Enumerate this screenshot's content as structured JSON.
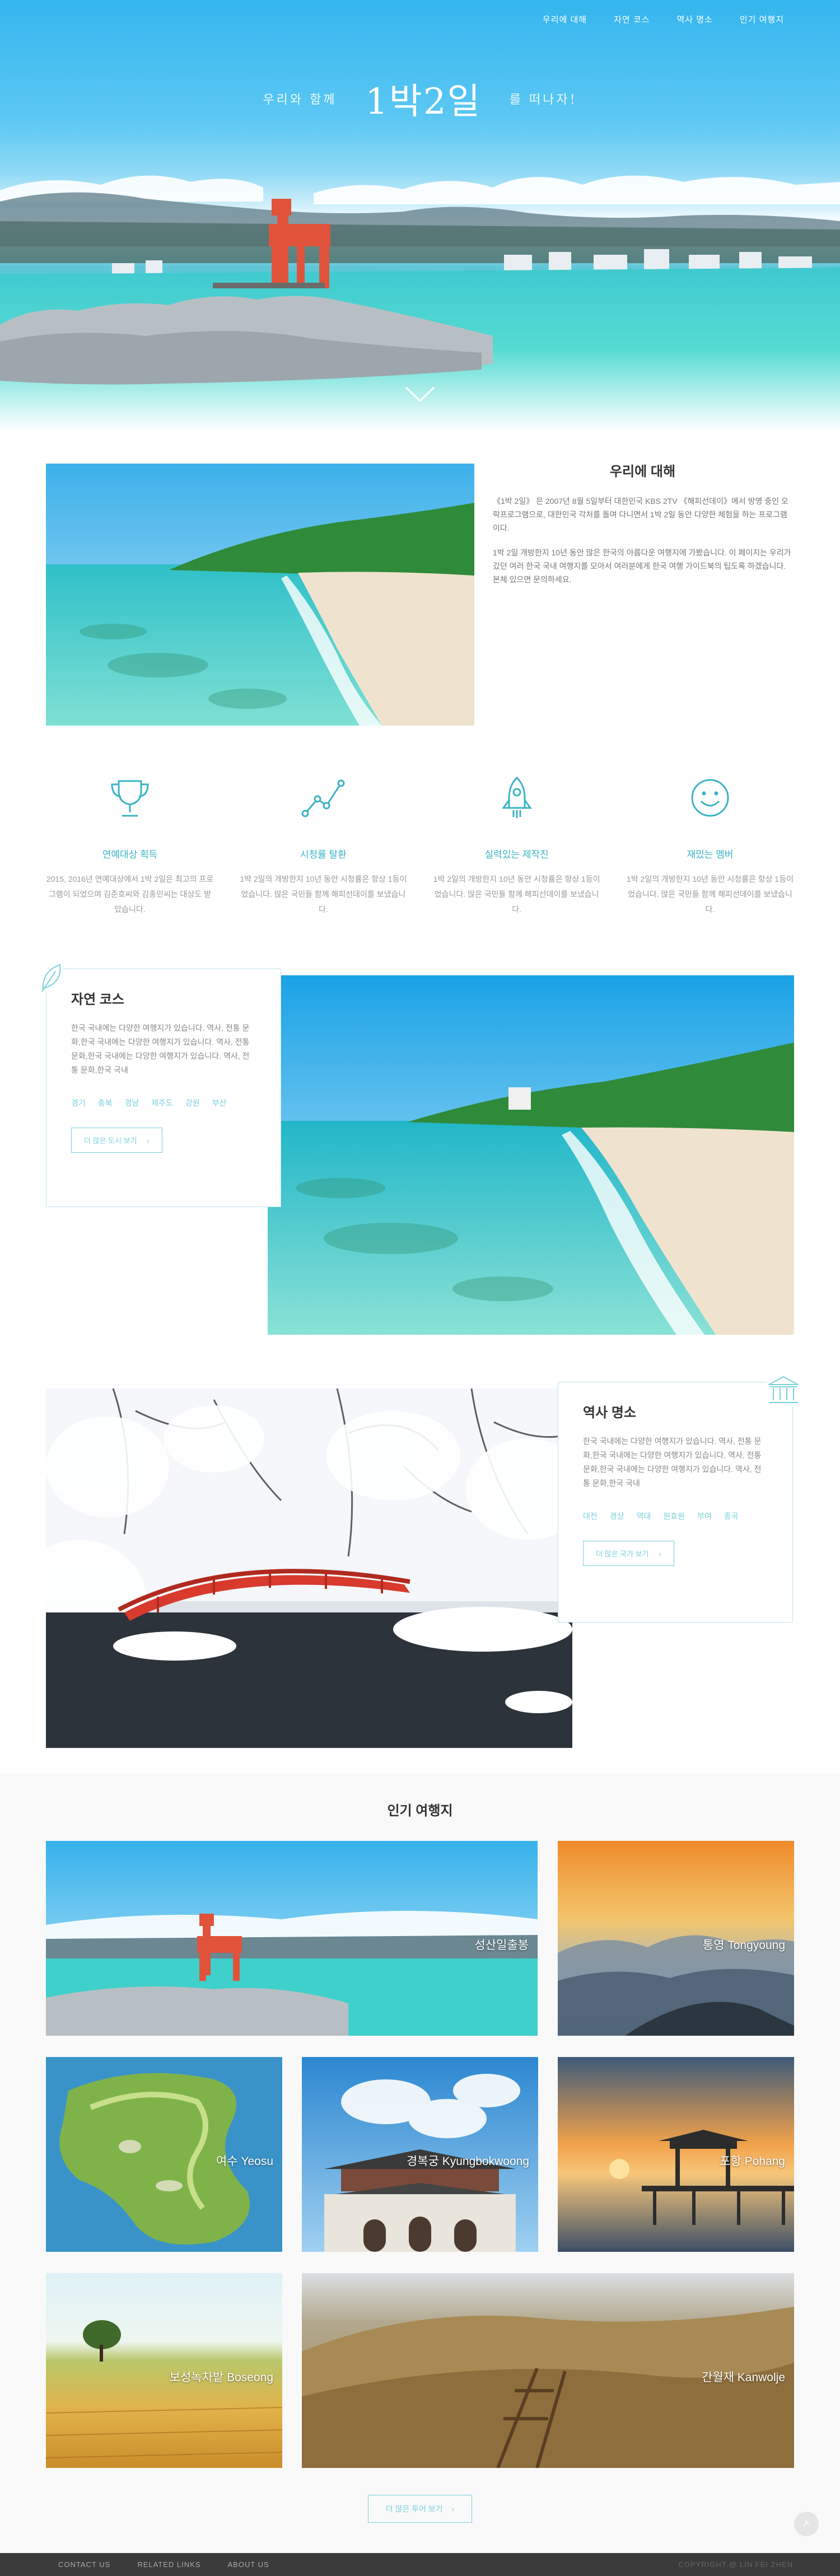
{
  "nav": {
    "items": [
      {
        "label": "우리에 대해"
      },
      {
        "label": "자연 코스"
      },
      {
        "label": "역사 명소"
      },
      {
        "label": "인기 여행지"
      }
    ]
  },
  "hero": {
    "pre": "우리와 함께",
    "title": "1박2일",
    "post": "를 떠나자!"
  },
  "about": {
    "title": "우리에 대해",
    "paragraphs": [
      "《1박 2일》 은 2007년 8월 5일부터 대한민국 KBS 2TV 《해피선데이》에서 방영 중인 오락프로그램으로, 대한민국 각처를 돌며 다니면서 1박 2일 동안 다양한 체험을 하는 프로그램이다.",
      "1박 2일 개방한지 10년 동안 많은 한국의 아름다운 여행지에 가봤습니다. 이 페이지는 우리가 갔던 여러 한국 국내 여행지를 모아서 여러분에게 한국 여행 가이드북의 팁도록 하겠습니다. 본체 있으면 문의하세요."
    ]
  },
  "features": [
    {
      "icon": "trophy-icon",
      "title": "연예대상 획득",
      "desc": "2015, 2016년 연예대상에서 1박 2일은 최고의 프로그램이 되었으며 김준호씨와 김종민씨는 대상도 받았습니다."
    },
    {
      "icon": "chart-line-icon",
      "title": "시청률 탈환",
      "desc": "1박 2일의 개방한지 10년 동안 시청률은 항상 1등이었습니다. 많은 국민들 함께 해피선데이를 보냈습니다."
    },
    {
      "icon": "rocket-icon",
      "title": "실력있는 제작진",
      "desc": "1박 2일의 개방한지 10년 동안 시청률은 항상 1등이었습니다. 많은 국민들 함께 해피선데이를 보냈습니다."
    },
    {
      "icon": "smiley-icon",
      "title": "재밌는 멤버",
      "desc": "1박 2일의 개방한지 10년 동안 시청률은 항상 1등이었습니다. 많은 국민들 함께 해피선데이를 보냈습니다."
    }
  ],
  "nature": {
    "title": "자연 코스",
    "desc": "한국 국내에는 다양한 여행지가 있습니다. 역사, 전통 문화,한국 국내에는 다양한 여행지가 있습니다. 역사, 전통 문화,한국 국내에는 다양한 여행지가 있습니다. 역사, 전통 문화,한국 국내",
    "tags": [
      "경기",
      "충북",
      "경남",
      "제주도",
      "강원",
      "부산"
    ],
    "more": "더 많은 도시 보기"
  },
  "history": {
    "title": "역사 명소",
    "desc": "한국 국내에는 다양한 여행지가 있습니다. 역사, 전통 문화,한국 국내에는 다양한 여행지가 있습니다. 역사, 전통 문화,한국 국내에는 다양한 여행지가 있습니다. 역사, 전통 문화,한국 국내",
    "tags": [
      "대전",
      "경상",
      "역대",
      "원효원",
      "부여",
      "종곡"
    ],
    "more": "더 많은 국가 보기"
  },
  "popular": {
    "title": "인기 여행지",
    "tiles": [
      {
        "label": "성산일출봉"
      },
      {
        "label": "통영 Tongyoung"
      },
      {
        "label": "여수 Yeosu"
      },
      {
        "label": "경복궁 Kyungbokwoong"
      },
      {
        "label": "포항 Pohang"
      },
      {
        "label": "보성녹차밭 Boseong"
      },
      {
        "label": "간월재 Kanwolje"
      }
    ],
    "more": "더 많은 투어 보기"
  },
  "footer": {
    "links": [
      {
        "label": "CONTACT US"
      },
      {
        "label": "RELATED LINKS"
      },
      {
        "label": "ABOUT US"
      }
    ],
    "copyright": "COPYRIGHT @ LIN FEI ZHEN"
  },
  "colors": {
    "accent": "#3bb3c6",
    "accent_light": "#78d0dc",
    "footer": "#3b3b3b"
  }
}
